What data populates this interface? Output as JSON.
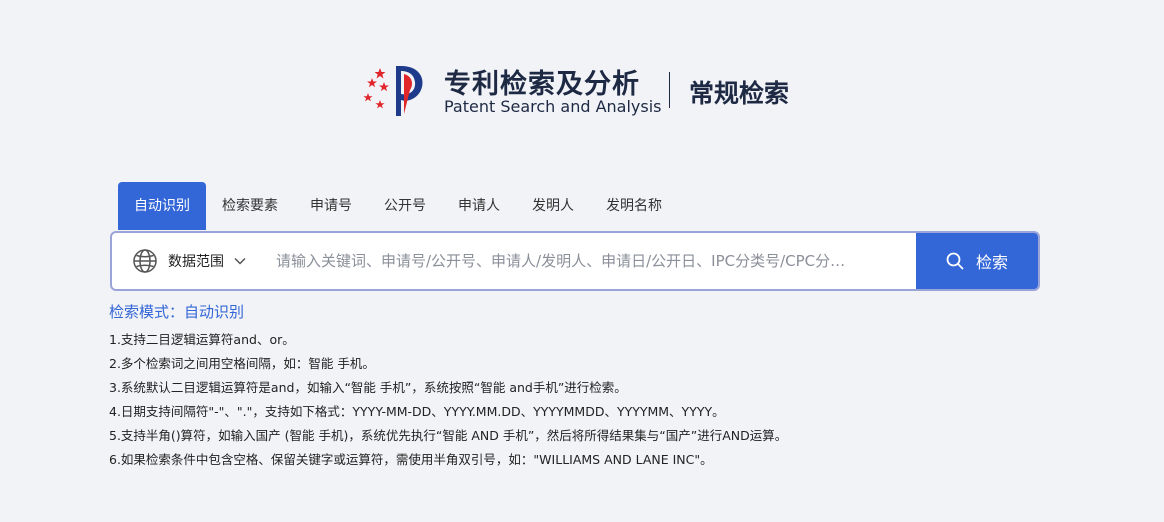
{
  "brand": {
    "name_cn": "专利检索及分析",
    "name_en": "Patent Search and Analysis"
  },
  "page_title": "常规检索",
  "tabs": [
    {
      "label": "自动识别",
      "active": true
    },
    {
      "label": "检索要素",
      "active": false
    },
    {
      "label": "申请号",
      "active": false
    },
    {
      "label": "公开号",
      "active": false
    },
    {
      "label": "申请人",
      "active": false
    },
    {
      "label": "发明人",
      "active": false
    },
    {
      "label": "发明名称",
      "active": false
    }
  ],
  "search": {
    "scope_label": "数据范围",
    "placeholder": "请输入关键词、申请号/公开号、申请人/发明人、申请日/公开日、IPC分类号/CPC分…",
    "value": "",
    "button_label": "检索"
  },
  "mode_text": "检索模式：自动识别",
  "rules": [
    "1.支持二目逻辑运算符and、or。",
    "2.多个检索词之间用空格间隔，如：智能 手机。",
    "3.系统默认二目逻辑运算符是and，如输入“智能 手机”，系统按照“智能 and手机”进行检索。",
    "4.日期支持间隔符\"-\"、\".\"，支持如下格式：YYYY-MM-DD、YYYY.MM.DD、YYYYMMDD、YYYYMM、YYYY。",
    "5.支持半角()算符，如输入国产 (智能 手机)，系统优先执行“智能 AND 手机”，然后将所得结果集与“国产”进行AND运算。",
    "6.如果检索条件中包含空格、保留关键字或运算符，需使用半角双引号，如：\"WILLIAMS AND LANE INC\"。"
  ],
  "colors": {
    "accent": "#3366d6",
    "background": "#f2f3f7",
    "brand_text": "#1e2a44",
    "logo_red": "#e0262b"
  },
  "icons": {
    "logo": "patent-logo-icon",
    "scope": "globe-icon",
    "dropdown": "chevron-down-icon",
    "search": "search-icon"
  }
}
